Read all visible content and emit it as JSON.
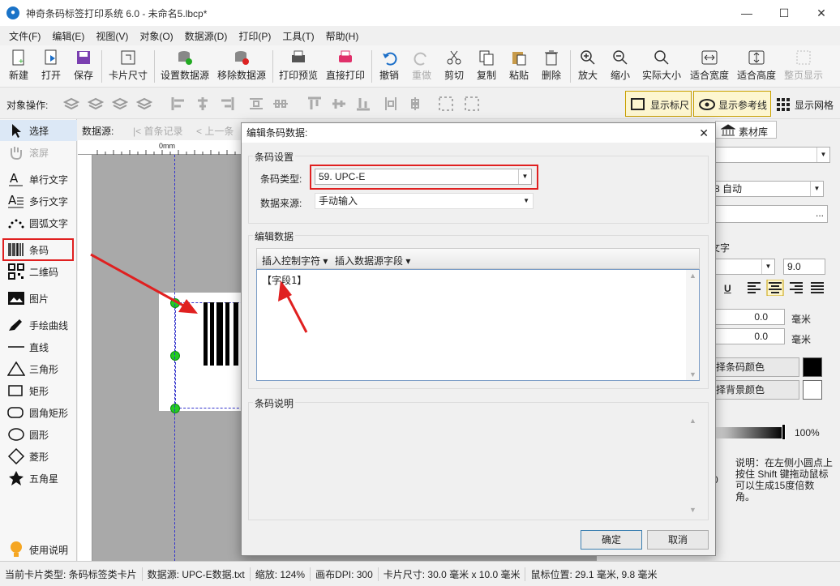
{
  "window": {
    "title": "神奇条码标签打印系统 6.0 - 未命名5.lbcp*"
  },
  "menu": [
    "文件(F)",
    "编辑(E)",
    "视图(V)",
    "对象(O)",
    "数据源(D)",
    "打印(P)",
    "工具(T)",
    "帮助(H)"
  ],
  "toolbar": {
    "new": "新建",
    "open": "打开",
    "save": "保存",
    "card_size": "卡片尺寸",
    "set_datasource": "设置数据源",
    "remove_datasource": "移除数据源",
    "print_preview": "打印预览",
    "direct_print": "直接打印",
    "undo": "撤销",
    "redo": "重做",
    "cut": "剪切",
    "copy": "复制",
    "paste": "粘贴",
    "delete": "删除",
    "zoom_in": "放大",
    "zoom_out": "缩小",
    "actual_size": "实际大小",
    "fit_width": "适合宽度",
    "fit_height": "适合高度",
    "page_fit": "整页显示"
  },
  "objbar": {
    "label": "对象操作:",
    "show_ruler": "显示标尺",
    "show_guides": "显示参考线",
    "show_grid": "显示网格"
  },
  "tools": [
    {
      "label": "选择"
    },
    {
      "label": "滚屏"
    },
    {
      "label": "单行文字"
    },
    {
      "label": "多行文字"
    },
    {
      "label": "圆弧文字"
    },
    {
      "label": "条码"
    },
    {
      "label": "二维码"
    },
    {
      "label": "图片"
    },
    {
      "label": "手绘曲线"
    },
    {
      "label": "直线"
    },
    {
      "label": "三角形"
    },
    {
      "label": "矩形"
    },
    {
      "label": "圆角矩形"
    },
    {
      "label": "圆形"
    },
    {
      "label": "菱形"
    },
    {
      "label": "五角星"
    },
    {
      "label": "使用说明"
    }
  ],
  "datasource_nav": {
    "label": "数据源:",
    "first": "首条记录",
    "prev": "上一条"
  },
  "ruler": {
    "origin": "0mm"
  },
  "dialog": {
    "title": "编辑条码数据:",
    "settings_group": "条码设置",
    "barcode_type_label": "条码类型:",
    "barcode_type_value": "59. UPC-E",
    "data_source_label": "数据来源:",
    "data_source_value": "手动输入",
    "edit_group": "编辑数据",
    "insert_control": "插入控制字符",
    "insert_field": "插入数据源字段",
    "data_value": "【字段1】",
    "desc_group": "条码说明",
    "ok": "确定",
    "cancel": "取消"
  },
  "rightpanel": {
    "tab_material": "素材库",
    "auto": "8 自动",
    "text_label": "文字",
    "font_size": "9.0",
    "offset1": "0.0",
    "offset2": "0.0",
    "unit": "毫米",
    "barcode_color": "择条码颜色",
    "bg_color": "择背景颜色",
    "opacity": "100%",
    "note": "说明：在左侧小圆点上按住 Shift 键拖动鼠标可以生成15度倍数角。",
    "zero": "0"
  },
  "status": {
    "card_type": "当前卡片类型: 条码标签类卡片",
    "datasource": "数据源: UPC-E数据.txt",
    "zoom": "缩放: 124%",
    "dpi": "画布DPI: 300",
    "card_size": "卡片尺寸: 30.0 毫米 x 10.0 毫米",
    "mouse_pos": "鼠标位置: 29.1 毫米, 9.8 毫米"
  },
  "colors": {
    "accent_red": "#e02020",
    "selection_green": "#22cc22"
  }
}
